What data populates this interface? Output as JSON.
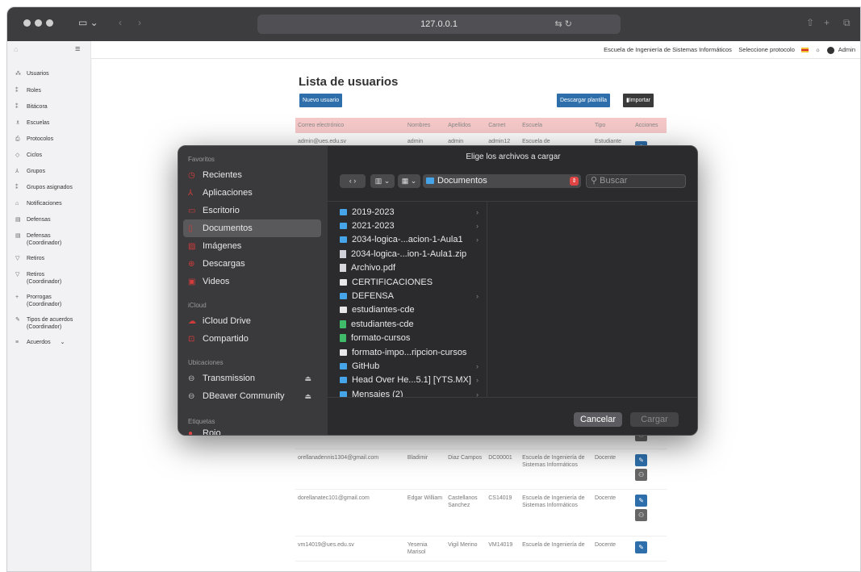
{
  "browser": {
    "url": "127.0.0.1",
    "icons": [
      "traffic-lights",
      "sidebar-toggle-icon",
      "back-icon",
      "forward-icon",
      "translate-icon",
      "reload-icon",
      "share-icon",
      "new-tab-icon",
      "tabs-icon"
    ]
  },
  "topnav": {
    "school": "Escuela de Ingeniería de Sistemas Informáticos",
    "protocol": "Seleccione protocolo",
    "user": "Admin"
  },
  "sidebar": {
    "items": [
      {
        "label": "Usuarios",
        "icon": "users-icon"
      },
      {
        "label": "Roles",
        "icon": "roles-icon"
      },
      {
        "label": "Bitácora",
        "icon": "log-icon"
      },
      {
        "label": "Escuelas",
        "icon": "school-icon"
      },
      {
        "label": "Protocolos",
        "icon": "protocol-icon"
      },
      {
        "label": "Ciclos",
        "icon": "cycle-icon"
      },
      {
        "label": "Grupos",
        "icon": "groups-icon"
      },
      {
        "label": "Grupos asignados",
        "icon": "assigned-groups-icon"
      },
      {
        "label": "Notificaciones",
        "icon": "bell-icon"
      },
      {
        "label": "Defensas",
        "icon": "defense-icon"
      },
      {
        "label": "Defensas (Coordinador)",
        "icon": "defense-coord-icon"
      },
      {
        "label": "Retiros",
        "icon": "withdraw-icon"
      },
      {
        "label": "Retiros (Coordinador)",
        "icon": "withdraw-coord-icon"
      },
      {
        "label": "Prorrogas (Coordinador)",
        "icon": "extension-icon"
      },
      {
        "label": "Tipos de acuerdos (Coordinador)",
        "icon": "agreement-types-icon"
      },
      {
        "label": "Acuerdos",
        "icon": "agreements-icon"
      }
    ]
  },
  "main": {
    "title": "Lista de usuarios",
    "new_user": "Nuevo usuario",
    "download_template": "Descargar plantilla",
    "import": "Importar",
    "columns": [
      "Correo electrónico",
      "Nombres",
      "Apellidos",
      "Carnet",
      "Escuela",
      "Tipo",
      "Acciones"
    ],
    "rows": [
      {
        "email": "admin@ues.edu.sv",
        "names": "admin",
        "surnames": "admin",
        "carnet": "admin12",
        "school": "Escuela de",
        "type": "Estudiante"
      },
      {
        "email": "orellanadennis1304@gmail.com",
        "names": "Bladimir",
        "surnames": "Diaz Campos",
        "carnet": "DC00001",
        "school": "Escuela de Ingeniería de Sistemas Informáticos",
        "type": "Docente"
      },
      {
        "email": "dorellanatec101@gmail.com",
        "names": "Edgar William",
        "surnames": "Castellanos Sanchez",
        "carnet": "CS14019",
        "school": "Escuela de Ingeniería de Sistemas Informáticos",
        "type": "Docente"
      },
      {
        "email": "vm14019@ues.edu.sv",
        "names": "Yesenia Marisol",
        "surnames": "Vigil Merino",
        "carnet": "VM14019",
        "school": "Escuela de Ingeniería de",
        "type": "Docente"
      }
    ]
  },
  "dialog": {
    "title": "Elige los archivos a cargar",
    "favorites_header": "Favoritos",
    "favorites": [
      {
        "label": "Recientes",
        "icon": "clock-icon"
      },
      {
        "label": "Aplicaciones",
        "icon": "apps-icon"
      },
      {
        "label": "Escritorio",
        "icon": "desktop-icon"
      },
      {
        "label": "Documentos",
        "icon": "document-icon"
      },
      {
        "label": "Imágenes",
        "icon": "image-icon"
      },
      {
        "label": "Descargas",
        "icon": "download-icon"
      },
      {
        "label": "Videos",
        "icon": "video-icon"
      }
    ],
    "icloud_header": "iCloud",
    "icloud": [
      {
        "label": "iCloud Drive",
        "icon": "cloud-icon"
      },
      {
        "label": "Compartido",
        "icon": "shared-folder-icon"
      }
    ],
    "locations_header": "Ubicaciones",
    "locations": [
      {
        "label": "Transmission",
        "icon": "drive-icon"
      },
      {
        "label": "DBeaver Community",
        "icon": "drive-icon"
      }
    ],
    "tags_header": "Etiquetas",
    "tags_partial": "Rojo",
    "location": "Documentos",
    "search_placeholder": "Buscar",
    "files": [
      {
        "name": "2019-2023",
        "kind": "folder",
        "chevron": true
      },
      {
        "name": "2021-2023",
        "kind": "folder",
        "chevron": true
      },
      {
        "name": "2034-logica-...acion-1-Aula1",
        "kind": "folder",
        "chevron": true
      },
      {
        "name": "2034-logica-...ion-1-Aula1.zip",
        "kind": "zip",
        "chevron": false
      },
      {
        "name": "Archivo.pdf",
        "kind": "pdf",
        "chevron": false
      },
      {
        "name": "CERTIFICACIONES",
        "kind": "doc",
        "chevron": false
      },
      {
        "name": "DEFENSA",
        "kind": "folder",
        "chevron": true
      },
      {
        "name": "estudiantes-cde",
        "kind": "white",
        "chevron": false
      },
      {
        "name": "estudiantes-cde",
        "kind": "sheet",
        "chevron": false
      },
      {
        "name": "formato-cursos",
        "kind": "sheet",
        "chevron": false
      },
      {
        "name": "formato-impo...ripcion-cursos",
        "kind": "white",
        "chevron": false
      },
      {
        "name": "GitHub",
        "kind": "folder",
        "chevron": true
      },
      {
        "name": "Head Over He...5.1] [YTS.MX]",
        "kind": "folder",
        "chevron": true
      },
      {
        "name": "Mensajes (2)",
        "kind": "folder",
        "chevron": true
      }
    ],
    "cancel": "Cancelar",
    "load": "Cargar"
  }
}
